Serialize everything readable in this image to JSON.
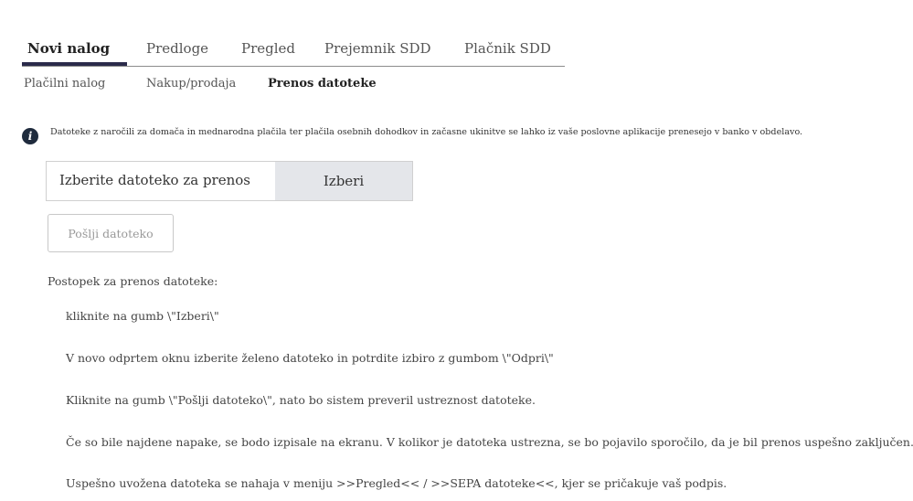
{
  "main_tabs": [
    {
      "label": "Novi nalog"
    },
    {
      "label": "Predloge"
    },
    {
      "label": "Pregled"
    },
    {
      "label": "Prejemnik SDD"
    },
    {
      "label": "Plačnik SDD"
    }
  ],
  "sub_tabs": [
    {
      "label": "Plačilni nalog"
    },
    {
      "label": "Nakup/prodaja"
    },
    {
      "label": "Prenos datoteke"
    }
  ],
  "info": {
    "icon": "info-icon",
    "text": "Datoteke z naročili za domača in mednarodna plačila ter plačila osebnih dohodkov in začasne ukinitve se lahko iz vaše poslovne aplikacije prenesejo v banko v obdelavo."
  },
  "file_select": {
    "label": "Izberite datoteko za prenos",
    "button_label": "Izberi"
  },
  "send_button_label": "Pošlji datoteko",
  "procedure": {
    "title": "Postopek za prenos datoteke:",
    "steps": [
      "kliknite na gumb \\\"Izberi\\\"",
      "V novo odprtem oknu izberite želeno datoteko in potrdite izbiro z gumbom \\\"Odpri\\\"",
      "Kliknite na gumb \\\"Pošlji datoteko\\\", nato bo sistem preveril ustreznost datoteke.",
      "Če so bile najdene napake, se bodo izpisale na ekranu. V kolikor je datoteka ustrezna, se bo pojavilo sporočilo, da je bil prenos uspešno zaključen.",
      "Uspešno uvožena datoteka se nahaja v meniju >>Pregled<< / >>SEPA datoteke<<, kjer se pričakuje vaš podpis."
    ]
  },
  "colors": {
    "active_underline": "#2a2a4a",
    "info_icon_bg": "#1f2b3d",
    "choose_button_bg": "#e4e6ea"
  }
}
